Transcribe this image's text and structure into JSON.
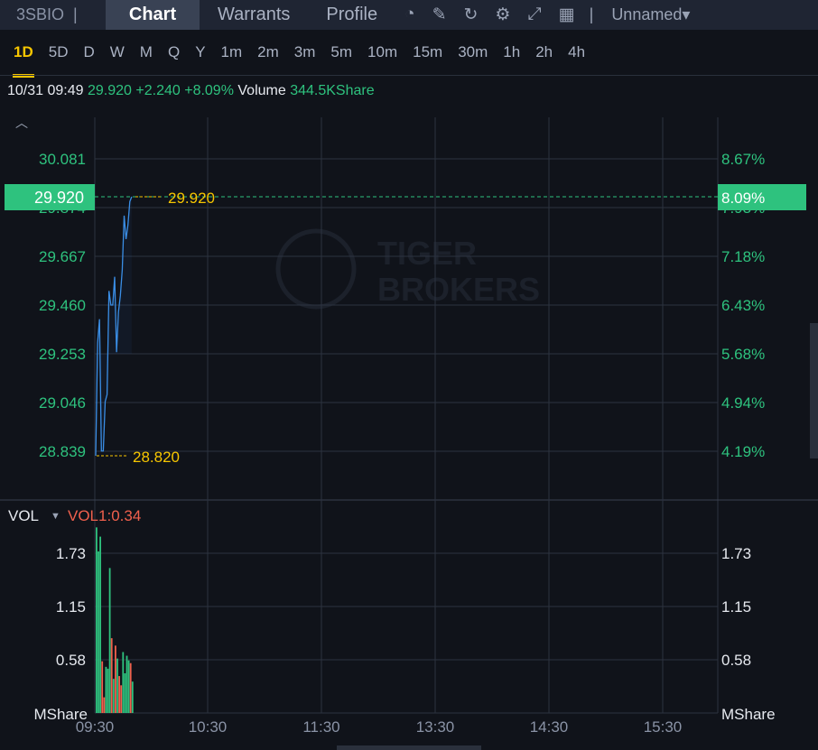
{
  "header": {
    "symbol": "3SBIO",
    "tabs": [
      "Chart",
      "Warrants",
      "Profile"
    ],
    "layout_name": "Unnamed"
  },
  "periods": [
    "1D",
    "5D",
    "D",
    "W",
    "M",
    "Q",
    "Y",
    "1m",
    "2m",
    "3m",
    "5m",
    "10m",
    "15m",
    "30m",
    "1h",
    "2h",
    "4h"
  ],
  "info": {
    "datetime": "10/31 09:49",
    "price": "29.920",
    "change": "+2.240",
    "change_pct": "+8.09%",
    "volume_label": "Volume",
    "volume": "344.5KShare"
  },
  "watermark": [
    "TIGER",
    "BROKERS"
  ],
  "chart_data": [
    {
      "type": "line",
      "title": "Price",
      "x_labels": [
        "09:30",
        "10:30",
        "11:30",
        "13:30",
        "14:30",
        "15:30"
      ],
      "y_ticks": [
        "30.081",
        "29.874",
        "29.667",
        "29.460",
        "29.253",
        "29.046",
        "28.839"
      ],
      "y_ticks_pct": [
        "8.67%",
        "7.93%",
        "7.18%",
        "6.43%",
        "5.68%",
        "4.94%",
        "4.19%"
      ],
      "ylim": [
        28.839,
        30.081
      ],
      "current_price": "29.920",
      "current_pct": "8.09%",
      "high_label": "29.920",
      "low_label": "28.820",
      "minutes": [
        0,
        1,
        2,
        3,
        4,
        5,
        6,
        7,
        8,
        9,
        10,
        11,
        12,
        13,
        14,
        15,
        16,
        17,
        18,
        19
      ],
      "values": [
        28.82,
        29.3,
        29.4,
        28.84,
        28.84,
        29.05,
        29.08,
        29.52,
        29.46,
        29.46,
        29.58,
        29.26,
        29.43,
        29.5,
        29.61,
        29.84,
        29.74,
        29.8,
        29.9,
        29.92
      ]
    },
    {
      "type": "bar",
      "title": "VOL",
      "indicator": "VOL1:0.34",
      "unit": "MShare",
      "y_ticks": [
        "1.73",
        "1.15",
        "0.58"
      ],
      "ylim": [
        0,
        2.1
      ],
      "values": [
        2.01,
        1.75,
        1.91,
        0.56,
        0.17,
        0.5,
        0.48,
        1.57,
        0.81,
        0.37,
        0.73,
        0.59,
        0.4,
        0.3,
        0.66,
        0.43,
        0.62,
        0.57,
        0.54,
        0.34
      ],
      "direction": [
        "up",
        "up",
        "up",
        "down",
        "down",
        "up",
        "up",
        "up",
        "down",
        "up",
        "down",
        "up",
        "down",
        "down",
        "up",
        "up",
        "up",
        "up",
        "down",
        "up"
      ]
    }
  ],
  "colors": {
    "up": "#2ec27e",
    "down": "#f0604d",
    "line": "#3a8ee6",
    "accent": "#f7c600"
  }
}
